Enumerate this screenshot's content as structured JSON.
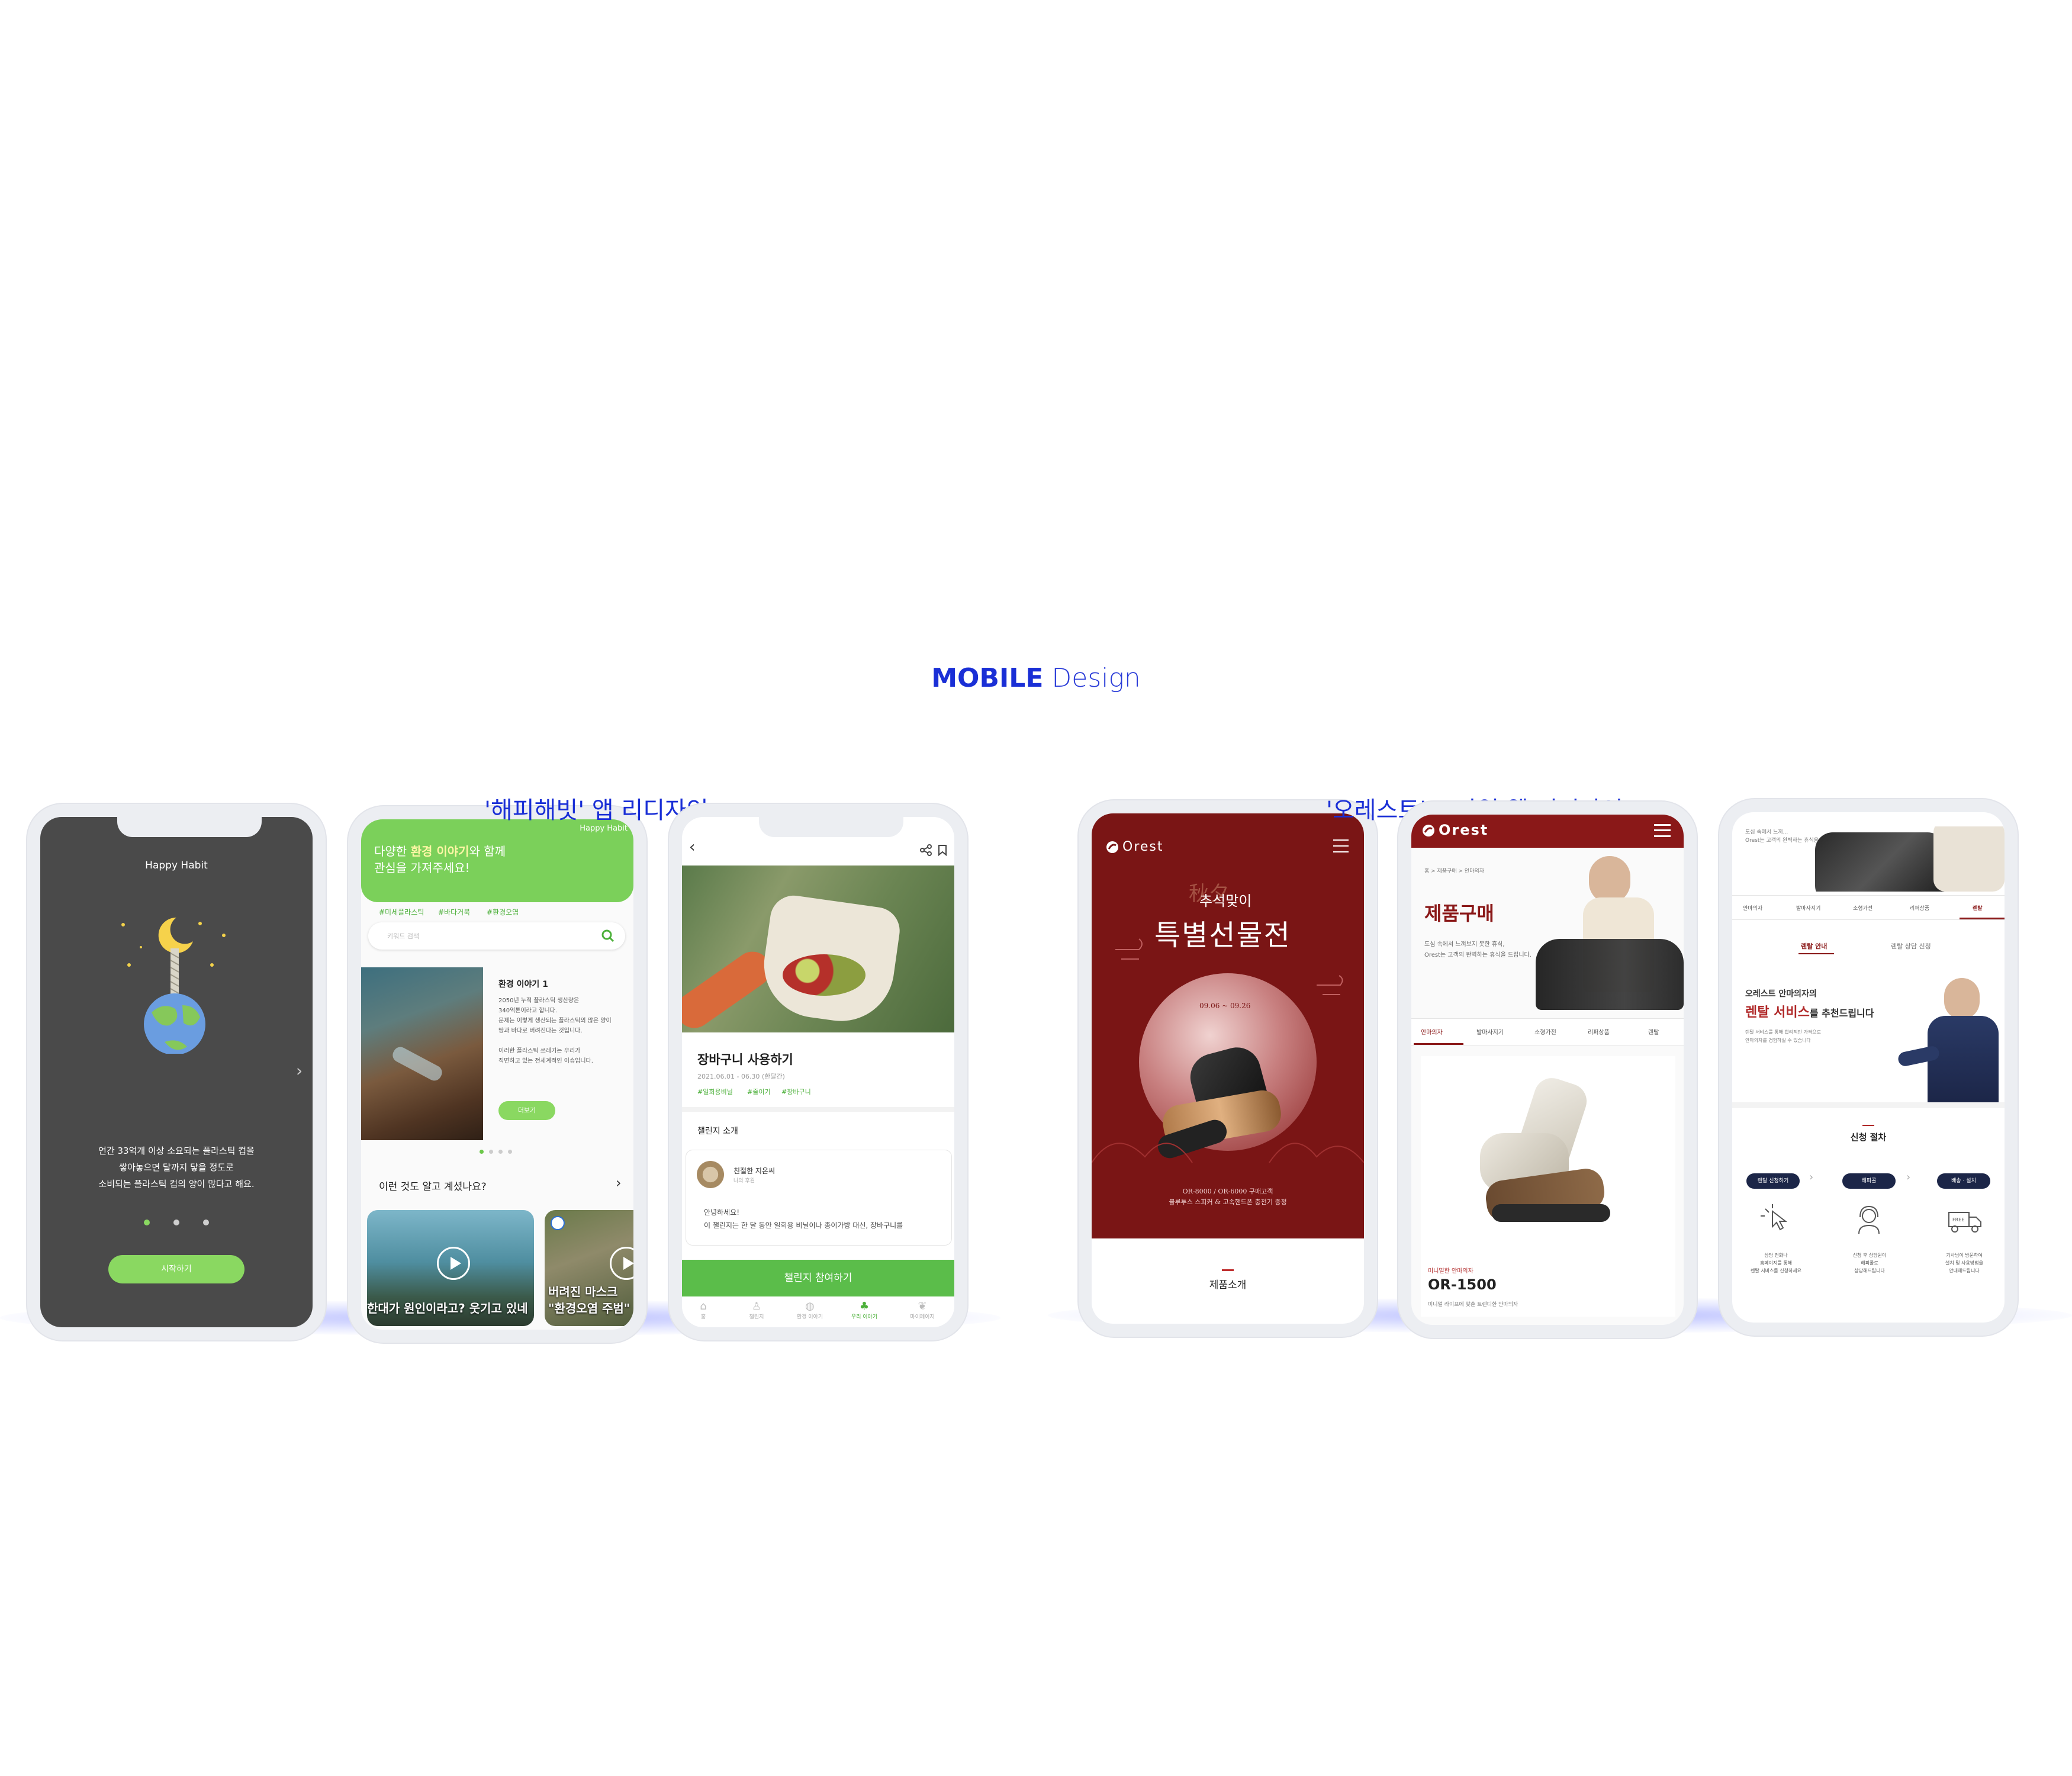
{
  "heading": {
    "bold": "MOBILE",
    "light": "Design"
  },
  "groups": {
    "happy": "'해피해빗' 앱 리디자인",
    "orest": "'오레스트' 모바일 웹 리디자인"
  },
  "phone1": {
    "app_title": "Happy Habit",
    "body": [
      "연간 33억개 이상 소요되는 플라스틱 컵을",
      "쌓아놓으면 달까지 닿을 정도로",
      "소비되는 플라스틱 컵의 양이 많다고 해요."
    ],
    "start_button": "시작하기",
    "page_count": 3,
    "active_page": 1
  },
  "phone2": {
    "header_line1_prefix": "다양한 ",
    "header_line1_highlight": "환경 이야기",
    "header_line1_suffix": "와 함께",
    "header_line2": "관심을 가져주세요!",
    "brand": "Happy Habit",
    "tags": [
      "#미세플라스틱",
      "#바다거북",
      "#환경오염"
    ],
    "search_placeholder": "키워드 검색",
    "story_title": "환경 이야기 1",
    "story_text": [
      "2050년 누적 플라스틱 생산량은",
      "340억톤이라고 합니다.",
      "문제는 이렇게 생산되는 플라스틱의 많은 양이",
      "땅과 바다로 버려진다는 것입니다.",
      "",
      "이러한 플라스틱 쓰레기는 우리가",
      "직면하고 있는 전세계적인 이슈입니다."
    ],
    "more_button": "더보기",
    "section_title": "이런 것도 알고 계셨나요?",
    "card1_caption": "한대가 원인이라고? 웃기고 있네",
    "card2_caption_line1": "버려진 마스크",
    "card2_caption_line2": "\"환경오염 주범\""
  },
  "phone3": {
    "title": "장바구니 사용하기",
    "date": "2021.06.01 - 06.30 (한달간)",
    "tags": [
      "#일회용비닐",
      "#줄이기",
      "#장바구니"
    ],
    "section": "챌린지 소개",
    "author_name": "친절한 지온씨",
    "author_sub": "나의 후원",
    "greeting": "안녕하세요!",
    "intro": "이 챌린지는 한 달 동안 일회용 비닐이나 종이가방 대신, 장바구니를",
    "cta": "챌린지 참여하기",
    "tabs": [
      "홈",
      "챌린지",
      "환경 이야기",
      "우리 이야기",
      "마이페이지"
    ],
    "active_tab": 3
  },
  "phone4": {
    "brand": "Orest",
    "hanja": "秋夕",
    "sub_title": "추석맞이",
    "title": "특별선물전",
    "dates": "09.06 ~ 09.26",
    "footer_line1": "OR-8000 / OR-6000 구매고객",
    "footer_line2": "블루투스 스피커 & 고속핸드폰 충전기 증정",
    "nav_label": "제품소개"
  },
  "phone5": {
    "brand": "Orest",
    "breadcrumb": "홈  >  제품구매  >  안마의자",
    "title": "제품구매",
    "desc_line1": "도심 속에서 느껴보지 못한 휴식,",
    "desc_line2": "Orest는 고객의 완벽하는 휴식을 드립니다.",
    "tabs": [
      "안마의자",
      "발마사지기",
      "소형가전",
      "리퍼상품",
      "렌탈"
    ],
    "active_tab": 0,
    "product_tag": "미니멀한 안마의자",
    "product_name": "OR-1500",
    "product_desc": "미니멀 라이프에 맞춘 트렌디한 안마의자"
  },
  "phone6": {
    "top_line1": "도심 속에서 느끼...",
    "top_line2": "Orest는 고객의 완벽하는 휴식을 드립니다.",
    "tabs": [
      "안마의자",
      "발마사지기",
      "소형가전",
      "리퍼상품",
      "렌탈"
    ],
    "active_tab": 4,
    "subtabs": [
      "렌탈 안내",
      "렌탈 상담 신청"
    ],
    "promo_line1": "오레스트 안마의자의",
    "promo_highlight": "렌탈 서비스",
    "promo_suffix": "를 추천드립니다",
    "promo_desc1": "렌탈 서비스를 통해 합리적인 가격으로",
    "promo_desc2": "안마의자를 경험하실 수 있습니다",
    "procedure_title": "신청 절차",
    "steps": [
      "렌탈 신청하기",
      "해피콜",
      "배송 · 설치"
    ],
    "step_desc": [
      [
        "상담 전화나",
        "홈페이지를 통해",
        "렌탈 서비스를 신청하세요"
      ],
      [
        "신청 후 상담원이",
        "해피콜로",
        "상담해드립니다"
      ],
      [
        "기사님이 방문하여",
        "설치 및 사용방법을",
        "안내해드립니다"
      ]
    ],
    "free_label": "FREE"
  },
  "colors": {
    "accent": "#1a2fd6",
    "green": "#6cc84a",
    "maroon": "#7a1515",
    "dark": "#4a4a4a"
  }
}
